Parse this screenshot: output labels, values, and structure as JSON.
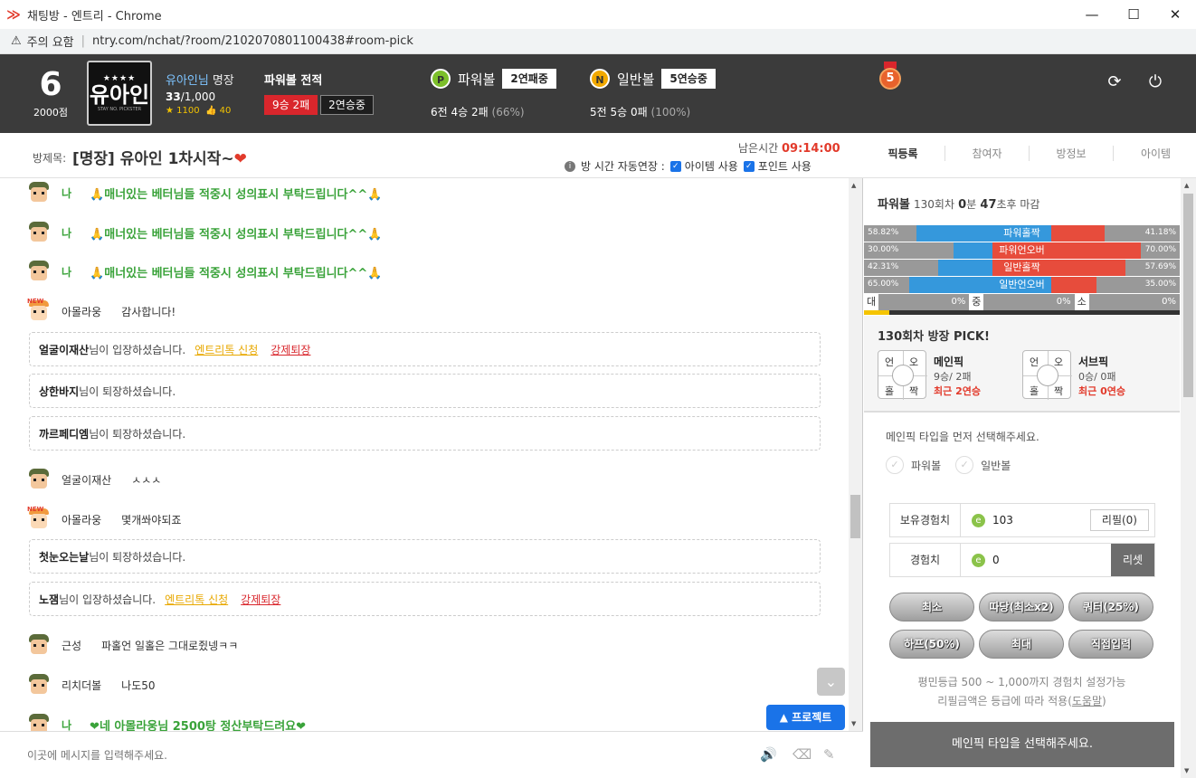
{
  "window": {
    "title": "채팅방 - 엔트리 - Chrome",
    "minimize": "—",
    "maximize": "☐",
    "close": "✕"
  },
  "address": {
    "warning": "주의 요함",
    "url": "ntry.com/nchat/?room/2102070801100438#room-pick"
  },
  "user": {
    "level": "6",
    "points": "2000점",
    "avatar_stars": "★★★★",
    "avatar_name": "유아인",
    "avatar_sub": "STAY NO. PICKSTER",
    "name": "유아인님",
    "rank": "명장",
    "count_now": "33",
    "count_max": "/1,000",
    "stars": "★ 1100",
    "likes": "👍 40"
  },
  "powerball_record": {
    "title": "파워볼 전적",
    "record": "9승 2패",
    "streak": "2연승중"
  },
  "powerball": {
    "icon": "P",
    "label": "파워볼",
    "streak": "2연패중",
    "s1": "6전",
    "s2": "4승",
    "s3": "2패",
    "pct": "(66%)",
    "color": "#7cbf2a"
  },
  "normalball": {
    "icon": "N",
    "label": "일반볼",
    "streak": "5연승중",
    "s1": "5전",
    "s2": "5승",
    "s3": "0패",
    "pct": "(100%)",
    "color": "#f2a900"
  },
  "medal": {
    "value": "5"
  },
  "header_icons": {
    "refresh": "⟳",
    "power": "⏻"
  },
  "room": {
    "label": "방제목:",
    "title": "[명장] 유아인 1차시작~",
    "remain_label": "남은시간",
    "remain": "09:14:00",
    "auto_label": "방 시간 자동연장 :",
    "item_use": "아이템 사용",
    "point_use": "포인트 사용"
  },
  "tabs": [
    "픽등록",
    "참여자",
    "방정보",
    "아이템"
  ],
  "chat": {
    "m1": {
      "nick": "나",
      "text": "🙏매너있는 베터님들 적중시 성의표시 부탁드립니다^^🙏"
    },
    "m2": {
      "nick": "나",
      "text": "🙏매너있는 베터님들 적중시 성의표시 부탁드립니다^^🙏"
    },
    "m3": {
      "nick": "나",
      "text": "🙏매너있는 베터님들 적중시 성의표시 부탁드립니다^^🙏"
    },
    "m4": {
      "nick": "아몰라웅",
      "text": "감사합니다!"
    },
    "s1": {
      "who": "얼굴이재산",
      "text": "님이 입장하셨습니다.",
      "link1": "엔트리톡 신청",
      "link2": "강제퇴장"
    },
    "s2": {
      "who": "상한바지",
      "text": "님이 퇴장하셨습니다."
    },
    "s3": {
      "who": "까르페디엠",
      "text": "님이 퇴장하셨습니다."
    },
    "m5": {
      "nick": "얼굴이재산",
      "text": "ㅅㅅㅅ"
    },
    "m6": {
      "nick": "아몰라웅",
      "text": "몇개쏴야되죠"
    },
    "s4": {
      "who": "첫눈오는날",
      "text": "님이 퇴장하셨습니다."
    },
    "s5": {
      "who": "노잼",
      "text": "님이 입장하셨습니다.",
      "link1": "엔트리톡 신청",
      "link2": "강제퇴장"
    },
    "m7": {
      "nick": "근성",
      "text": "파홀언 일홀은 그대로쥤넹ㅋㅋ"
    },
    "m8": {
      "nick": "리치더볼",
      "text": "나도50"
    },
    "m9": {
      "nick": "나",
      "text": "❤네 아몰라웅님 2500탕 정산부탁드려요❤"
    },
    "new_tag": "NEW"
  },
  "protect_btn": "▲ 프로젝트",
  "down_btn": "⌄",
  "input": {
    "placeholder": "이곳에 메시지를 입력해주세요.",
    "icons": [
      "🔊",
      "⌫",
      "✎"
    ]
  },
  "pb_round": {
    "name": "파워볼",
    "round": "130회차",
    "min": "0",
    "min_unit": "분",
    "sec": "47",
    "sec_unit": "초후 마감"
  },
  "bars": [
    {
      "left": "58.82%",
      "label": "파워홀짝",
      "right": "41.18%",
      "lv": 0.5882,
      "rv": 0.4118,
      "mid": "blue"
    },
    {
      "left": "30.00%",
      "label": "파워언오버",
      "right": "70.00%",
      "lv": 0.3,
      "rv": 0.7,
      "mid": "red"
    },
    {
      "left": "42.31%",
      "label": "일반홀짝",
      "right": "57.69%",
      "lv": 0.4231,
      "rv": 0.5769,
      "mid": "red"
    },
    {
      "left": "65.00%",
      "label": "일반언오버",
      "right": "35.00%",
      "lv": 0.65,
      "rv": 0.35,
      "mid": "blue"
    }
  ],
  "dzs": [
    {
      "k": "대",
      "v": "0%"
    },
    {
      "k": "중",
      "v": "0%"
    },
    {
      "k": "소",
      "v": "0%"
    }
  ],
  "pick": {
    "title": "130회차 방장 PICK!",
    "q": [
      "언",
      "오",
      "홀",
      "짝"
    ],
    "main": {
      "name": "메인픽",
      "stat": "9승/ 2패",
      "recent": "최근 2연승"
    },
    "sub": {
      "name": "서브픽",
      "stat": "0승/ 0패",
      "recent": "최근 0연승"
    }
  },
  "guide": "메인픽 타입을 먼저 선택해주세요.",
  "radio": [
    "파워볼",
    "일반볼"
  ],
  "exp": {
    "own_label": "보유경험치",
    "own_value": "103",
    "refill": "리필(0)",
    "label": "경험치",
    "value": "0",
    "reset": "리셋",
    "icon": "e"
  },
  "bet_btns": [
    "최소",
    "따당(최소x2)",
    "쿼터(25%)",
    "하프(50%)",
    "최대",
    "직접입력"
  ],
  "notes": {
    "n1": "평민등급 500 ~ 1,000까지 경험치 설정가능",
    "n2a": "리필금액은 등급에 따라 적용(",
    "n2b": "도움말",
    "n2c": ")"
  },
  "submit": "메인픽 타입을 선택해주세요."
}
